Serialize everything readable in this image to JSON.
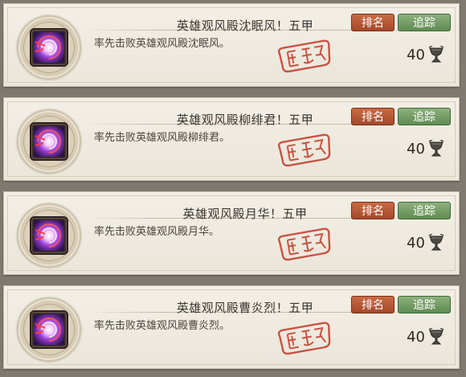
{
  "items": [
    {
      "title": "英雄观风殿沈眠风！五甲",
      "desc": "率先击败英雄观风殿沈眠风。",
      "rank_label": "排名",
      "track_label": "追踪",
      "reward_amount": "40"
    },
    {
      "title": "英雄观风殿柳绯君！五甲",
      "desc": "率先击败英雄观风殿柳绯君。",
      "rank_label": "排名",
      "track_label": "追踪",
      "reward_amount": "40"
    },
    {
      "title": "英雄观风殿月华！五甲",
      "desc": "率先击败英雄观风殿月华。",
      "rank_label": "排名",
      "track_label": "追踪",
      "reward_amount": "40"
    },
    {
      "title": "英雄观风殿曹炎烈！五甲",
      "desc": "率先击败英雄观风殿曹炎烈。",
      "rank_label": "排名",
      "track_label": "追踪",
      "reward_amount": "40"
    }
  ],
  "icons": {
    "emblem": "purple-swirl-emblem-icon",
    "seal": "red-completed-seal-icon",
    "reward": "bronze-goblet-icon"
  },
  "colors": {
    "rank_button": "#b3552f",
    "track_button": "#6f9a60",
    "seal_red": "#c23a2a",
    "card_bg": "#f1ede3"
  }
}
